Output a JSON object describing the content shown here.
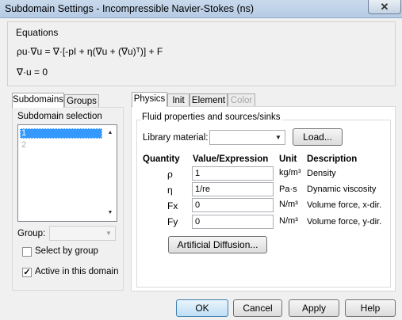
{
  "window": {
    "title": "Subdomain Settings - Incompressible Navier-Stokes (ns)",
    "close_glyph": "✕"
  },
  "equations": {
    "title": "Equations",
    "line1": "ρu·∇u = ∇·[-pI + η(∇u + (∇u)ᵀ)] + F",
    "line2": "∇·u = 0"
  },
  "left_tabs": [
    "Subdomains",
    "Groups"
  ],
  "subdomain_selection": {
    "label": "Subdomain selection",
    "items": [
      "1",
      "2"
    ],
    "selected": "1"
  },
  "group": {
    "label": "Group:",
    "value": ""
  },
  "select_by_group": {
    "label": "Select by group",
    "checked": false
  },
  "active_in_domain": {
    "label": "Active in this domain",
    "checked": true
  },
  "right_tabs": [
    "Physics",
    "Init",
    "Element",
    "Color"
  ],
  "physics": {
    "section_title": "Fluid properties and sources/sinks",
    "library_material_label": "Library material:",
    "library_material_value": "",
    "load_button": "Load...",
    "headers": {
      "quantity": "Quantity",
      "value": "Value/Expression",
      "unit": "Unit",
      "description": "Description"
    },
    "rows": [
      {
        "quantity": "ρ",
        "value": "1",
        "unit": "kg/m³",
        "description": "Density"
      },
      {
        "quantity": "η",
        "value": "1/re",
        "unit": "Pa·s",
        "description": "Dynamic viscosity"
      },
      {
        "quantity": "Fx",
        "value": "0",
        "unit": "N/m³",
        "description": "Volume force, x-dir."
      },
      {
        "quantity": "Fy",
        "value": "0",
        "unit": "N/m³",
        "description": "Volume force, y-dir."
      }
    ],
    "artificial_diffusion_button": "Artificial Diffusion..."
  },
  "footer": {
    "ok": "OK",
    "cancel": "Cancel",
    "apply": "Apply",
    "help": "Help"
  }
}
